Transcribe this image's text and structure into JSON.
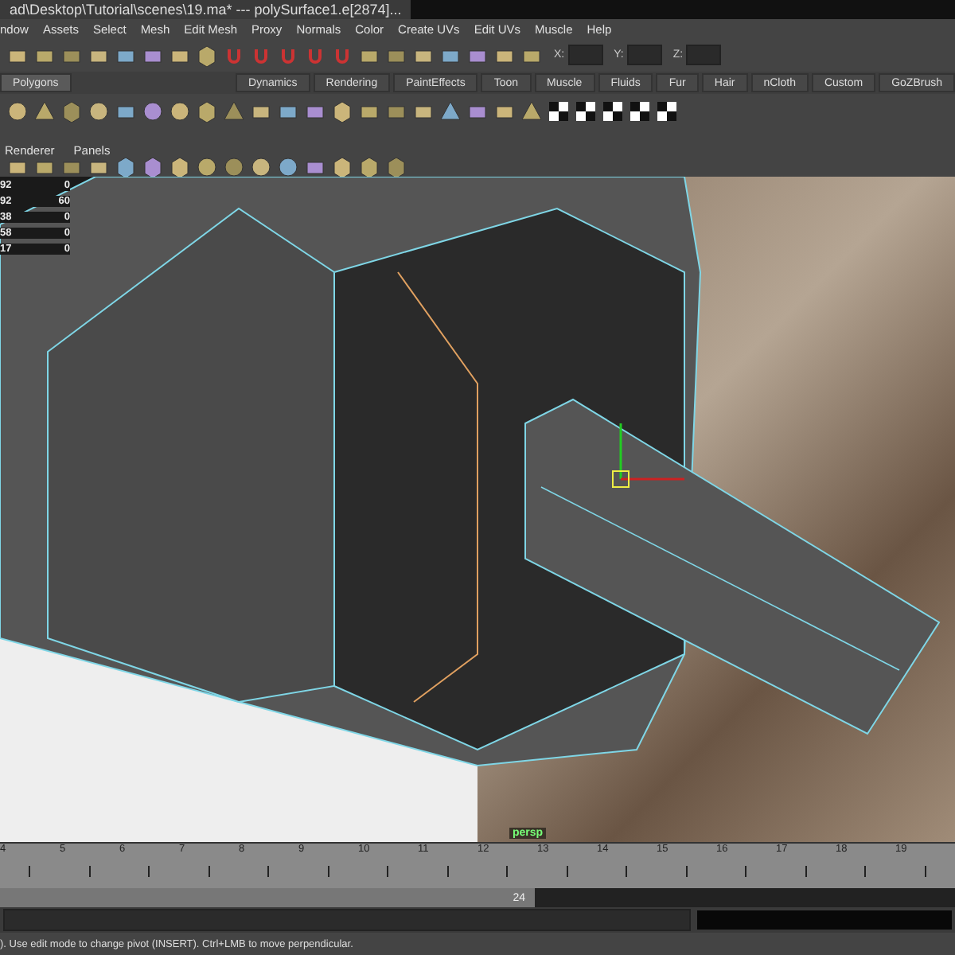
{
  "window": {
    "title": "ad\\Desktop\\Tutorial\\scenes\\19.ma*  ---  polySurface1.e[2874]..."
  },
  "menu": [
    "ndow",
    "Assets",
    "Select",
    "Mesh",
    "Edit Mesh",
    "Proxy",
    "Normals",
    "Color",
    "Create UVs",
    "Edit UVs",
    "Muscle",
    "Help"
  ],
  "status_line": {
    "fields": [
      {
        "label": "X:"
      },
      {
        "label": "Y:"
      },
      {
        "label": "Z:"
      }
    ]
  },
  "shelf_tabs": [
    {
      "label": "Polygons",
      "selected": true
    },
    {
      "label": "Dynamics",
      "selected": false
    },
    {
      "label": "Rendering",
      "selected": false
    },
    {
      "label": "PaintEffects",
      "selected": false
    },
    {
      "label": "Toon",
      "selected": false
    },
    {
      "label": "Muscle",
      "selected": false
    },
    {
      "label": "Fluids",
      "selected": false
    },
    {
      "label": "Fur",
      "selected": false
    },
    {
      "label": "Hair",
      "selected": false
    },
    {
      "label": "nCloth",
      "selected": false
    },
    {
      "label": "Custom",
      "selected": false
    },
    {
      "label": "GoZBrush",
      "selected": false
    }
  ],
  "panel_menu": [
    "Renderer",
    "Panels"
  ],
  "hud_rows": [
    {
      "name": "92",
      "value": "0"
    },
    {
      "name": "92",
      "value": "60"
    },
    {
      "name": "38",
      "value": "0"
    },
    {
      "name": "58",
      "value": "0"
    },
    {
      "name": "17",
      "value": "0"
    }
  ],
  "viewport": {
    "camera": "persp"
  },
  "time_slider": {
    "ticks": [
      "4",
      "5",
      "6",
      "7",
      "8",
      "9",
      "10",
      "11",
      "12",
      "13",
      "14",
      "15",
      "16",
      "17",
      "18",
      "19"
    ]
  },
  "range_slider": {
    "end": "24",
    "level": 0.56
  },
  "help_line": "). Use edit mode to change pivot (INSERT).  Ctrl+LMB to move perpendicular."
}
